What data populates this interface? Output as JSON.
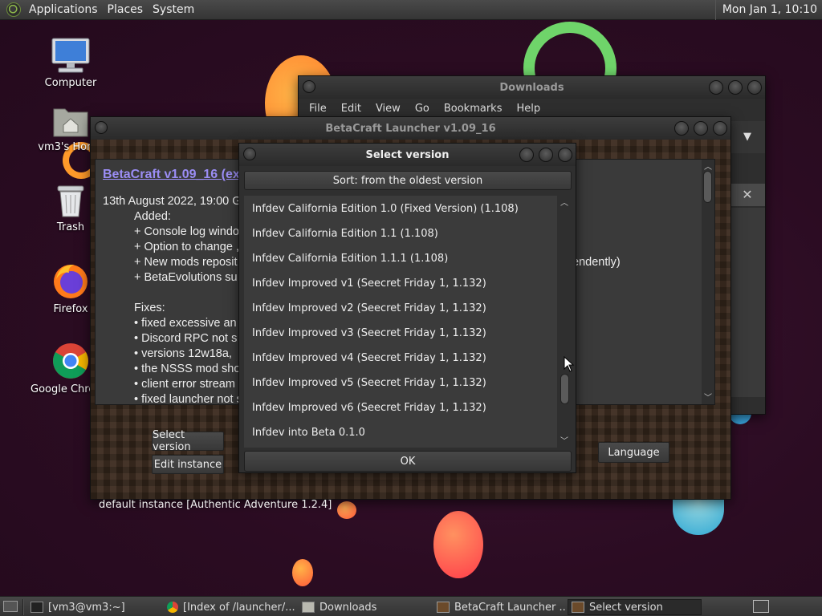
{
  "top_panel": {
    "menus": [
      "Applications",
      "Places",
      "System"
    ],
    "clock": "Mon Jan  1, 10:10"
  },
  "desktop_icons": [
    {
      "label": "Computer",
      "icon": "computer-icon"
    },
    {
      "label": "vm3's Home",
      "icon": "home-folder-icon"
    },
    {
      "label": "Trash",
      "icon": "trash-icon"
    },
    {
      "label": "Firefox",
      "icon": "firefox-icon"
    },
    {
      "label": "Google Chrome",
      "icon": "chrome-icon"
    }
  ],
  "downloads_window": {
    "title": "Downloads",
    "menu": [
      "File",
      "Edit",
      "View",
      "Go",
      "Bookmarks",
      "Help"
    ]
  },
  "betacraft_window": {
    "title": "BetaCraft Launcher v1.09_16",
    "news_title": "BetaCraft v1.09_16 (ex",
    "news_lines": [
      "13th August 2022, 19:00 G",
      "Added:",
      "+ Console log windo",
      "+ Option to change ,",
      "+ New mods reposit",
      "+ BetaEvolutions su",
      "Fixes:",
      "• fixed excessive an",
      "• Discord RPC not s",
      "• versions 12w18a,",
      "• the NSSS mod sho",
      "• client error stream",
      "• fixed launcher not s"
    ],
    "news_right_fragment": "endently)",
    "select_version_button": "Select version",
    "edit_instance_button": "Edit instance",
    "language_button": "Language",
    "instance_text": "default instance [Authentic Adventure 1.2.4]"
  },
  "select_version_dialog": {
    "title": "Select version",
    "sort_button": "Sort: from the oldest version",
    "versions": [
      "Infdev California Edition 1.0 (Fixed Version) (1.108)",
      "Infdev California Edition 1.1 (1.108)",
      "Infdev California Edition 1.1.1 (1.108)",
      "Infdev Improved v1 (Seecret Friday 1, 1.132)",
      "Infdev Improved v2 (Seecret Friday 1, 1.132)",
      "Infdev Improved v3 (Seecret Friday 1, 1.132)",
      "Infdev Improved v4 (Seecret Friday 1, 1.132)",
      "Infdev Improved v5 (Seecret Friday 1, 1.132)",
      "Infdev Improved v6 (Seecret Friday 1, 1.132)",
      "Infdev into Beta 0.1.0"
    ],
    "ok_button": "OK"
  },
  "taskbar": {
    "tasks": [
      {
        "label": "[vm3@vm3:~]",
        "icon": "terminal-icon",
        "active": false
      },
      {
        "label": "[Index of /launcher/...",
        "icon": "chrome-icon",
        "active": false
      },
      {
        "label": "Downloads",
        "icon": "folder-icon",
        "active": false
      },
      {
        "label": "BetaCraft Launcher ...",
        "icon": "betacraft-icon",
        "active": false
      },
      {
        "label": "Select version",
        "icon": "betacraft-icon",
        "active": true
      }
    ]
  },
  "colors": {
    "accent_link": "#9b8df5",
    "panel": "#3d3d3d",
    "wallpaper": "#2c0d22"
  }
}
